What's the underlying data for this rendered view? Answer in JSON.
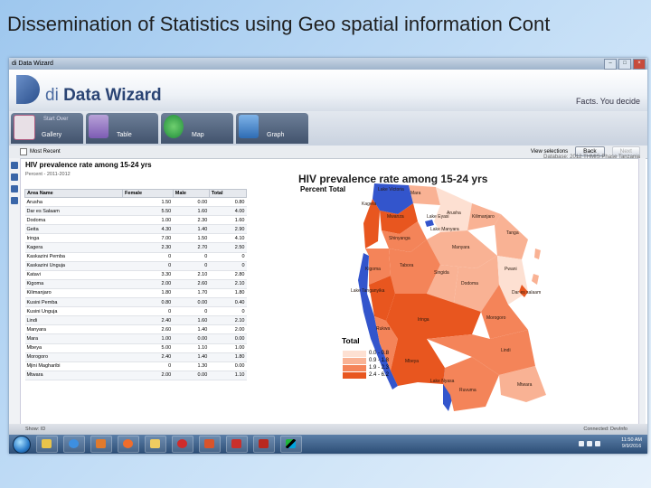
{
  "slide": {
    "title": "Dissemination of Statistics using Geo spatial information Cont"
  },
  "window": {
    "title": "di Data Wizard"
  },
  "app": {
    "logo_di": "di",
    "logo_name": "Data Wizard",
    "tagline": "Facts. You decide",
    "dataset_label": "Database: 2012 THMIS Phase Tanzania"
  },
  "tabs": [
    {
      "label": "Gallery",
      "sub": "Start Over"
    },
    {
      "label": "Table",
      "sub": ""
    },
    {
      "label": "Map",
      "sub": ""
    },
    {
      "label": "Graph",
      "sub": ""
    }
  ],
  "toolbar": {
    "most_recent": "Most Recent",
    "view_selections": "View selections",
    "back": "Back",
    "next": "Next",
    "dim_label": "Info / Tools"
  },
  "panel": {
    "title": "HIV prevalence rate among 15-24 yrs",
    "subtitle": "Percent - 2011-2012"
  },
  "table": {
    "columns": [
      "Area Name",
      "Female",
      "Male",
      "Total"
    ],
    "rows": [
      [
        "Arusha",
        "1.50",
        "0.00",
        "0.80"
      ],
      [
        "Dar es Salaam",
        "5.50",
        "1.60",
        "4.00"
      ],
      [
        "Dodoma",
        "1.00",
        "2.30",
        "1.60"
      ],
      [
        "Geita",
        "4.30",
        "1.40",
        "2.90"
      ],
      [
        "Iringa",
        "7.00",
        "1.50",
        "4.10"
      ],
      [
        "Kagera",
        "2.30",
        "2.70",
        "2.50"
      ],
      [
        "Kaskazini Pemba",
        "0",
        "0",
        "0"
      ],
      [
        "Kaskazini Unguja",
        "0",
        "0",
        "0"
      ],
      [
        "Katavi",
        "3.30",
        "2.10",
        "2.80"
      ],
      [
        "Kigoma",
        "2.00",
        "2.60",
        "2.10"
      ],
      [
        "Kilimanjaro",
        "1.80",
        "1.70",
        "1.80"
      ],
      [
        "Kusini Pemba",
        "0.80",
        "0.00",
        "0.40"
      ],
      [
        "Kusini Unguja",
        "0",
        "0",
        "0"
      ],
      [
        "Lindi",
        "2.40",
        "1.60",
        "2.10"
      ],
      [
        "Manyara",
        "2.60",
        "1.40",
        "2.00"
      ],
      [
        "Mara",
        "1.00",
        "0.00",
        "0.00"
      ],
      [
        "Mbeya",
        "5.00",
        "1.10",
        "1.00"
      ],
      [
        "Morogoro",
        "2.40",
        "1.40",
        "1.80"
      ],
      [
        "Mjini Magharibi",
        "0",
        "1.30",
        "0.00"
      ],
      [
        "Mtwara",
        "2.00",
        "0.00",
        "1.10"
      ]
    ]
  },
  "map": {
    "title": "HIV prevalence rate among 15-24 yrs",
    "subtitle": "Percent Total",
    "legend_title": "Total",
    "legend": [
      {
        "label": "0.0 - 0.8",
        "color": "#fde0d2"
      },
      {
        "label": "0.9 - 1.8",
        "color": "#f9b294"
      },
      {
        "label": "1.9 - 2.3",
        "color": "#f48459"
      },
      {
        "label": "2.4 - 6.2",
        "color": "#e8561f"
      }
    ],
    "region_labels": [
      "Lake Victoria",
      "Mara",
      "Kagera",
      "Mwanza",
      "Lake Eyasi",
      "Shinyanga",
      "Lake Manyara",
      "Kilimanjaro",
      "Arusha",
      "Tanga",
      "Manyara",
      "Kigoma",
      "Tabora",
      "Singida",
      "Dodoma",
      "Lake Tanganyika",
      "Rukwa",
      "Iringa",
      "Dar es salaam",
      "Morogoro",
      "Mbeya",
      "Ruvuma",
      "Lindi",
      "Mtwara",
      "Lake Nyasa",
      "Pwani"
    ],
    "colors": {
      "water": "#3355cc",
      "land_light": "#fde0d2"
    }
  },
  "status": {
    "left": "Show: ID",
    "right": "Connected: DevInfo"
  },
  "tray": {
    "time": "11:50 AM",
    "date": "9/9/2016"
  }
}
